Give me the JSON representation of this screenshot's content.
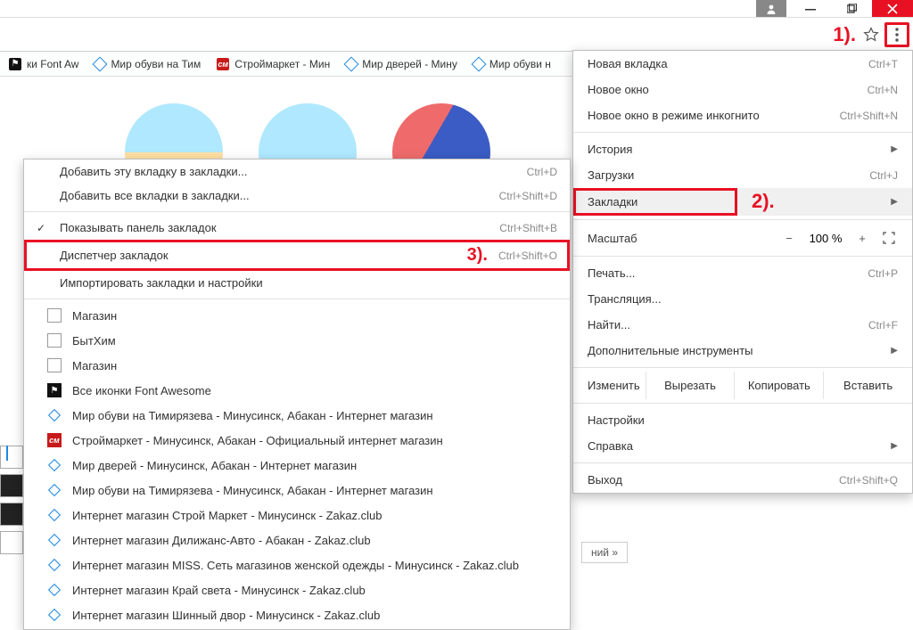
{
  "window": {
    "user_icon": "👤"
  },
  "toolbar": {},
  "bookmarks_bar": [
    {
      "label": "ки Font Aw",
      "favicon": "fa"
    },
    {
      "label": "Мир обуви на Тим",
      "favicon": "diamond"
    },
    {
      "label": "Строймаркет - Мин",
      "favicon": "cm"
    },
    {
      "label": "Мир дверей - Мину",
      "favicon": "diamond"
    },
    {
      "label": "Мир обуви н",
      "favicon": "diamond"
    }
  ],
  "main_menu": {
    "new_tab": {
      "label": "Новая вкладка",
      "shortcut": "Ctrl+T"
    },
    "new_window": {
      "label": "Новое окно",
      "shortcut": "Ctrl+N"
    },
    "incognito": {
      "label": "Новое окно в режиме инкогнито",
      "shortcut": "Ctrl+Shift+N"
    },
    "history": {
      "label": "История"
    },
    "downloads": {
      "label": "Загрузки",
      "shortcut": "Ctrl+J"
    },
    "bookmarks": {
      "label": "Закладки"
    },
    "zoom": {
      "label": "Масштаб",
      "value": "100 %"
    },
    "print": {
      "label": "Печать...",
      "shortcut": "Ctrl+P"
    },
    "cast": {
      "label": "Трансляция..."
    },
    "find": {
      "label": "Найти...",
      "shortcut": "Ctrl+F"
    },
    "more_tools": {
      "label": "Дополнительные инструменты"
    },
    "edit": {
      "label": "Изменить",
      "cut": "Вырезать",
      "copy": "Копировать",
      "paste": "Вставить"
    },
    "settings": {
      "label": "Настройки"
    },
    "help": {
      "label": "Справка"
    },
    "exit": {
      "label": "Выход",
      "shortcut": "Ctrl+Shift+Q"
    }
  },
  "sub_menu": {
    "add_this": {
      "label": "Добавить эту вкладку в закладки...",
      "shortcut": "Ctrl+D"
    },
    "add_all": {
      "label": "Добавить все вкладки в закладки...",
      "shortcut": "Ctrl+Shift+D"
    },
    "show_bar": {
      "label": "Показывать панель закладок",
      "shortcut": "Ctrl+Shift+B"
    },
    "manager": {
      "label": "Диспетчер закладок",
      "shortcut": "Ctrl+Shift+O"
    },
    "import": {
      "label": "Импортировать закладки и настройки"
    },
    "items": [
      {
        "label": "Магазин",
        "favicon": "page"
      },
      {
        "label": "БытХим",
        "favicon": "page"
      },
      {
        "label": "Магазин",
        "favicon": "page"
      },
      {
        "label": "Все иконки Font Awesome",
        "favicon": "fa"
      },
      {
        "label": "Мир обуви на Тимирязева - Минусинск, Абакан - Интернет магазин",
        "favicon": "diamond"
      },
      {
        "label": "Строймаркет - Минусинск, Абакан - Официальный интернет магазин",
        "favicon": "cm"
      },
      {
        "label": "Мир дверей - Минусинск, Абакан - Интернет магазин",
        "favicon": "diamond"
      },
      {
        "label": "Мир обуви на Тимирязева - Минусинск, Абакан - Интернет магазин",
        "favicon": "diamond"
      },
      {
        "label": "Интернет магазин Строй Маркет - Минусинск - Zakaz.club",
        "favicon": "diamond"
      },
      {
        "label": "Интернет магазин Дилижанс-Авто - Абакан - Zakaz.club",
        "favicon": "diamond"
      },
      {
        "label": "Интернет магазин MISS. Сеть магазинов женской одежды - Минусинск - Zakaz.club",
        "favicon": "diamond"
      },
      {
        "label": "Интернет магазин Край света - Минусинск - Zakaz.club",
        "favicon": "diamond"
      },
      {
        "label": "Интернет магазин Шинный двор - Минусинск - Zakaz.club",
        "favicon": "diamond"
      }
    ]
  },
  "annotations": {
    "one": "1).",
    "two": "2).",
    "three": "3)."
  },
  "bottom_tag": "ний »"
}
